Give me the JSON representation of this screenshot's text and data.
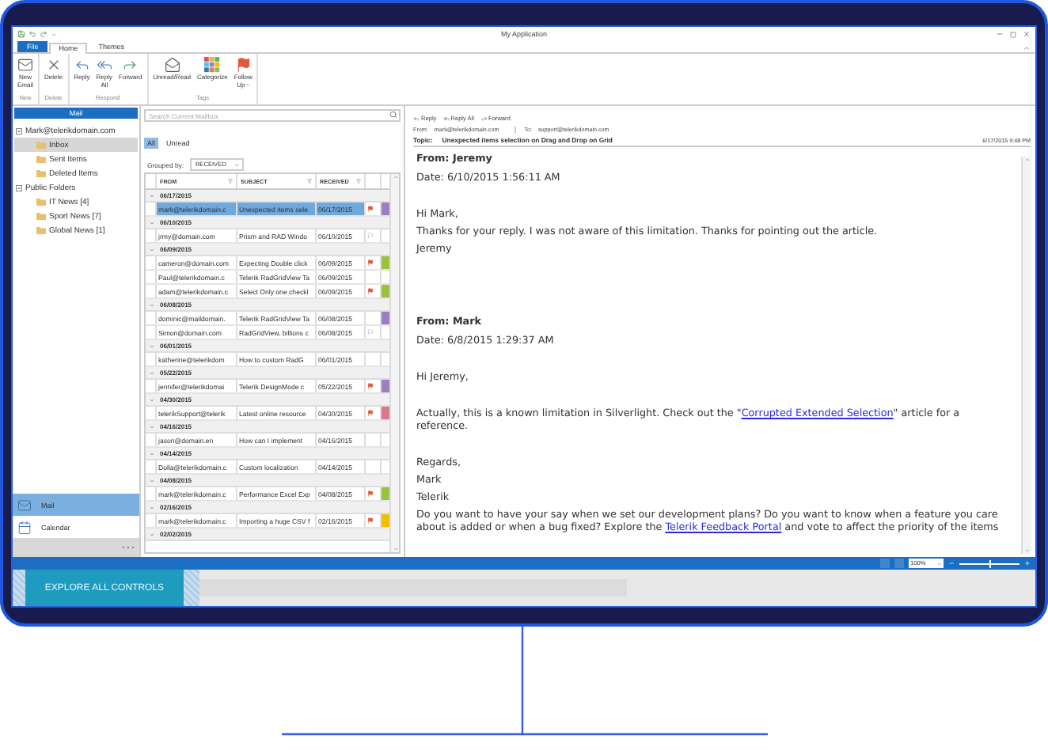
{
  "window": {
    "title": "My Application"
  },
  "ribbon_tabs": [
    {
      "label": "File",
      "kind": "file",
      "selected": false
    },
    {
      "label": "Home",
      "kind": "tab",
      "selected": true
    },
    {
      "label": "Themes",
      "kind": "tab",
      "selected": false
    }
  ],
  "ribbon_groups": [
    {
      "label": "New",
      "buttons": [
        {
          "label": "New Email",
          "kind": "new-mail"
        }
      ]
    },
    {
      "label": "Delete",
      "buttons": [
        {
          "label": "Delete",
          "kind": "delete"
        }
      ]
    },
    {
      "label": "Respond",
      "buttons": [
        {
          "label": "Reply",
          "kind": "reply"
        },
        {
          "label": "Reply All",
          "kind": "reply-all"
        },
        {
          "label": "Forward",
          "kind": "forward"
        }
      ]
    },
    {
      "label": "Tags",
      "buttons": [
        {
          "label": "Unread/Read",
          "kind": "read"
        },
        {
          "label": "Categorize",
          "kind": "categorize"
        },
        {
          "label": "Follow Up",
          "kind": "follow-up"
        }
      ]
    }
  ],
  "navigation": {
    "header": "Mail",
    "tree": [
      {
        "label": "Mark@telerikdomain.com",
        "expanded": true,
        "selected": false,
        "children": [
          {
            "label": "Inbox",
            "selected": true
          },
          {
            "label": "Sent Items",
            "selected": false
          },
          {
            "label": "Deleted Items",
            "selected": false
          }
        ]
      },
      {
        "label": "Public Folders",
        "expanded": true,
        "selected": false,
        "children": [
          {
            "label": "IT News [4]",
            "selected": false
          },
          {
            "label": "Sport News [7]",
            "selected": false
          },
          {
            "label": "Global News [1]",
            "selected": false
          }
        ]
      }
    ],
    "buttons": [
      {
        "label": "Mail",
        "kind": "mail",
        "selected": true
      },
      {
        "label": "Calendar",
        "kind": "calendar",
        "selected": false
      }
    ]
  },
  "mail_list": {
    "search": {
      "placeholder": "Search Current Mailbox"
    },
    "filters": [
      {
        "label": "All",
        "selected": true
      },
      {
        "label": "Unread",
        "selected": false
      }
    ],
    "grouped_by_label": "Grouped by:",
    "grouped_by": "RECEIVED",
    "columns": [
      "FROM",
      "SUBJECT",
      "RECEIVED"
    ],
    "groups": [
      {
        "date": "06/17/2015",
        "expanded": true,
        "rows": [
          {
            "from": "mark@telerikdomain.c",
            "subject": "Unexpected items sele",
            "received": "06/17/2015",
            "flagged": true,
            "completed": false,
            "color": "#9b7fc0",
            "selected": true
          }
        ]
      },
      {
        "date": "06/10/2015",
        "expanded": true,
        "rows": [
          {
            "from": "jrmy@domain.com",
            "subject": "Prism and RAD Windo",
            "received": "06/10/2015",
            "flagged": false,
            "completed": true,
            "selected": false
          }
        ]
      },
      {
        "date": "06/09/2015",
        "expanded": true,
        "rows": [
          {
            "from": "cameron@domain.com",
            "subject": "Expecting Double click",
            "received": "06/09/2015",
            "flagged": true,
            "completed": false,
            "color": "#9ac23c",
            "selected": false
          },
          {
            "from": "Paul@telerikdomain.c",
            "subject": "Telerik RadGridView Ta",
            "received": "06/09/2015",
            "flagged": false,
            "completed": false,
            "selected": false
          },
          {
            "from": "adam@telerikdomain.c",
            "subject": "Select Only one checkl",
            "received": "06/09/2015",
            "flagged": true,
            "completed": false,
            "color": "#9ac23c",
            "selected": false
          }
        ]
      },
      {
        "date": "06/08/2015",
        "expanded": true,
        "rows": [
          {
            "from": "dominic@maildomain.",
            "subject": "Telerik RadGridView Ta",
            "received": "06/08/2015",
            "flagged": false,
            "completed": false,
            "color": "#9b7fc0",
            "selected": false
          },
          {
            "from": "Simon@domain.com",
            "subject": "RadGridView, billions c",
            "received": "06/08/2015",
            "flagged": false,
            "completed": true,
            "selected": false
          }
        ]
      },
      {
        "date": "06/01/2015",
        "expanded": true,
        "rows": [
          {
            "from": "katherine@telerikdom",
            "subject": "How to custom RadG",
            "received": "06/01/2015",
            "flagged": false,
            "completed": false,
            "selected": false
          }
        ]
      },
      {
        "date": "05/22/2015",
        "expanded": true,
        "rows": [
          {
            "from": "jennifer@telerikdomai",
            "subject": "Telerik DesignMode c",
            "received": "05/22/2015",
            "flagged": true,
            "completed": false,
            "color": "#9b7fc0",
            "selected": false
          }
        ]
      },
      {
        "date": "04/30/2015",
        "expanded": true,
        "rows": [
          {
            "from": "telerikSupport@telerik",
            "subject": "Latest online resource",
            "received": "04/30/2015",
            "flagged": true,
            "completed": false,
            "color": "#d9788a",
            "selected": false
          }
        ]
      },
      {
        "date": "04/16/2015",
        "expanded": true,
        "rows": [
          {
            "from": "jason@domain.en",
            "subject": "How can I implement",
            "received": "04/16/2015",
            "flagged": false,
            "completed": false,
            "selected": false
          }
        ]
      },
      {
        "date": "04/14/2015",
        "expanded": true,
        "rows": [
          {
            "from": "Dolla@telerikdomain.c",
            "subject": "Custom localization",
            "received": "04/14/2015",
            "flagged": false,
            "completed": false,
            "selected": false
          }
        ]
      },
      {
        "date": "04/08/2015",
        "expanded": true,
        "rows": [
          {
            "from": "mark@telerikdomain.c",
            "subject": "Performance Excel Exp",
            "received": "04/08/2015",
            "flagged": true,
            "completed": false,
            "color": "#9ac23c",
            "selected": false
          }
        ]
      },
      {
        "date": "02/16/2015",
        "expanded": true,
        "rows": [
          {
            "from": "mark@telerikdomain.c",
            "subject": "Importing a huge CSV f",
            "received": "02/16/2015",
            "flagged": true,
            "completed": false,
            "color": "#f0c000",
            "selected": false
          }
        ]
      },
      {
        "date": "02/02/2015",
        "expanded": true
      }
    ]
  },
  "reading_pane": {
    "actions": [
      {
        "label": "Reply",
        "kind": "reply"
      },
      {
        "label": "Reply All",
        "kind": "reply-all"
      },
      {
        "label": "Forward",
        "kind": "forward"
      }
    ],
    "from_label": "From:",
    "from": "mark@telerikdomain.com",
    "to_label": "To:",
    "to": "support@telerikdomain.com",
    "topic_label": "Topic:",
    "topic": "Unexpected items selection on Drag and Drop on Grid",
    "date": "6/17/2015 9:48 PM",
    "body": [
      {
        "kind": "heading",
        "parts": [
          {
            "text": "From: Jeremy"
          }
        ]
      },
      {
        "kind": "date",
        "parts": [
          {
            "text": "Date: 6/10/2015 1:56:11 AM"
          }
        ]
      },
      {
        "kind": "paragraph",
        "parts": [
          {
            "text": "Hi Mark,"
          }
        ]
      },
      {
        "kind": "line",
        "parts": [
          {
            "text": " Thanks for your reply. I was not aware of this limitation. Thanks for pointing out the article."
          }
        ]
      },
      {
        "kind": "line",
        "parts": [
          {
            "text": "Jeremy"
          }
        ]
      },
      {
        "kind": "heading",
        "parts": [
          {
            "text": "From: Mark"
          }
        ]
      },
      {
        "kind": "date",
        "parts": [
          {
            "text": "Date: 6/8/2015 1:29:37 AM"
          }
        ]
      },
      {
        "kind": "paragraph",
        "parts": [
          {
            "text": "Hi Jeremy,"
          }
        ]
      },
      {
        "kind": "paragraph",
        "parts": [
          {
            "text": "Actually, this is a known limitation in Silverlight. Check out the \""
          },
          {
            "text": "Corrupted Extended Selection",
            "kind": "link"
          },
          {
            "text": "\" article for a reference."
          }
        ]
      },
      {
        "kind": "paragraph",
        "parts": [
          {
            "text": "Regards,"
          }
        ]
      },
      {
        "kind": "line",
        "parts": [
          {
            "text": "Mark"
          }
        ]
      },
      {
        "kind": "line",
        "parts": [
          {
            "text": "Telerik"
          }
        ]
      },
      {
        "kind": "line",
        "parts": [
          {
            "text": "Do you want to have your say when we set our development plans? Do you want to know when a feature you care about is added or when a bug fixed? Explore the "
          },
          {
            "text": "Telerik Feedback Portal",
            "kind": "link"
          },
          {
            "text": " and vote to affect the priority of the items"
          }
        ]
      }
    ]
  },
  "status_bar": {
    "zoom": "100%",
    "level": 0.5
  },
  "explore_button": "EXPLORE ALL CONTROLS"
}
